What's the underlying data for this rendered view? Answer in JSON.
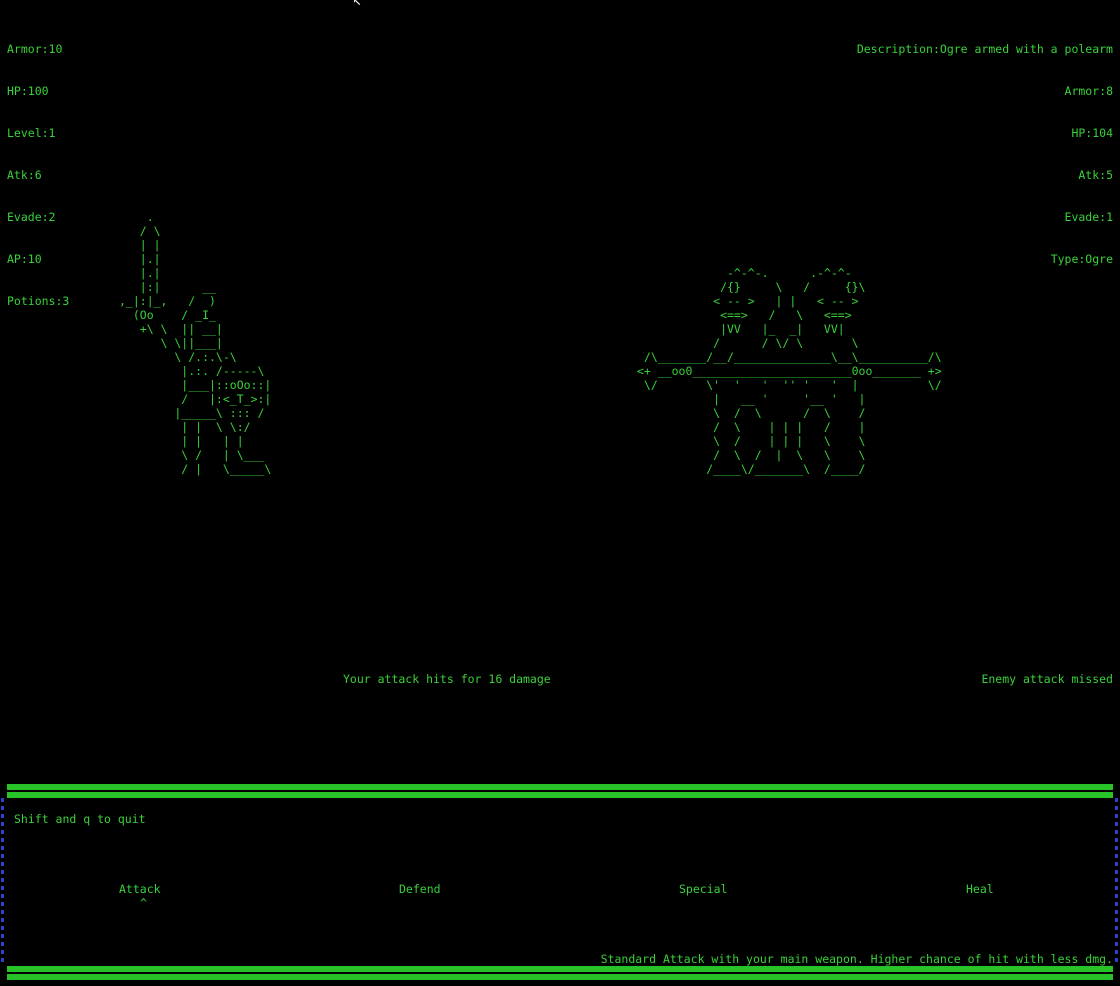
{
  "player": {
    "armor": "Armor:10",
    "hp": "HP:100",
    "level": "Level:1",
    "atk": "Atk:6",
    "evade": "Evade:2",
    "ap": "AP:10",
    "potions": "Potions:3"
  },
  "enemy": {
    "description": "Description:Ogre armed with a polearm",
    "armor": "Armor:8",
    "hp": "HP:104",
    "atk": "Atk:5",
    "evade": "Evade:1",
    "type": "Type:Ogre"
  },
  "art": {
    "player": "    .\n   / \\\n   | |\n   |.|\n   |.|\n   |:|      __\n,_|:|_,   /  )\n  (Oo    / _I_\n   +\\ \\  || __|\n      \\ \\||___|\n        \\ /.:.\\-\\\n         |.:. /-----\\\n         |___|::oOo::|\n         /   |:<_T_>:|\n        |_____\\ ::: /\n         | |  \\ \\:/\n         | |   | |\n         \\ /   | \\___\n         / |   \\_____\\",
    "enemy": "             -^-^-.      .-^-^-\n            /{}     \\   /     {}\\\n           < -- >   | |   < -- >\n            <==>   /   \\   <==>\n            |VV   |_  _|   VV|\n           /      / \\/ \\       \\\n /\\_______/__/______________\\__\\__________/\\\n<+ __oo0_______________________0oo_______ +>\n \\/       \\'  '   '  '' '   '  |          \\/\n           |   __ '     '__ '   |\n           \\  /  \\      /  \\    /\n           /  \\    | | |   /    |\n           \\  /    | | |   \\    \\\n           /  \\  /  |  \\   \\    \\\n          /____\\/_______\\  /____/"
  },
  "log": {
    "player": "Your attack hits for 16 damage",
    "enemy": "Enemy attack missed"
  },
  "ui": {
    "quit_hint": "Shift and q to quit",
    "menu": [
      "Attack",
      "Defend",
      "Special",
      "Heal"
    ],
    "cursor": "^",
    "description": "Standard Attack with your main weapon. Higher chance of hit with less dmg."
  },
  "colors": {
    "text": "#3ad13a",
    "background": "#000000",
    "border_bar": "#27c227",
    "side_dots": "#2f3fd0"
  }
}
